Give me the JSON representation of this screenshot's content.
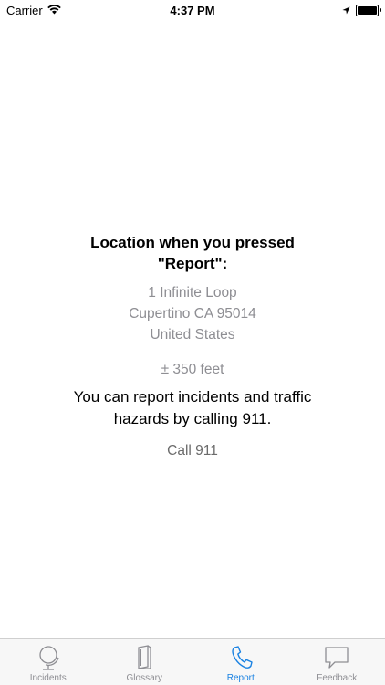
{
  "status_bar": {
    "carrier": "Carrier",
    "time": "4:37 PM"
  },
  "content": {
    "heading": "Location when you pressed \"Report\":",
    "address_lines": [
      "1 Infinite Loop",
      "Cupertino CA 95014",
      "United States"
    ],
    "accuracy": "± 350 feet",
    "report_text": "You can report incidents and traffic hazards by calling 911.",
    "call_button": "Call 911"
  },
  "tabs": [
    {
      "label": "Incidents",
      "icon": "globe-icon",
      "active": false
    },
    {
      "label": "Glossary",
      "icon": "book-icon",
      "active": false
    },
    {
      "label": "Report",
      "icon": "phone-icon",
      "active": true
    },
    {
      "label": "Feedback",
      "icon": "speech-bubble-icon",
      "active": false
    }
  ],
  "colors": {
    "accent": "#1a82e2",
    "inactive": "#8e8e93",
    "tab_bar_background": "#f7f7f7"
  }
}
